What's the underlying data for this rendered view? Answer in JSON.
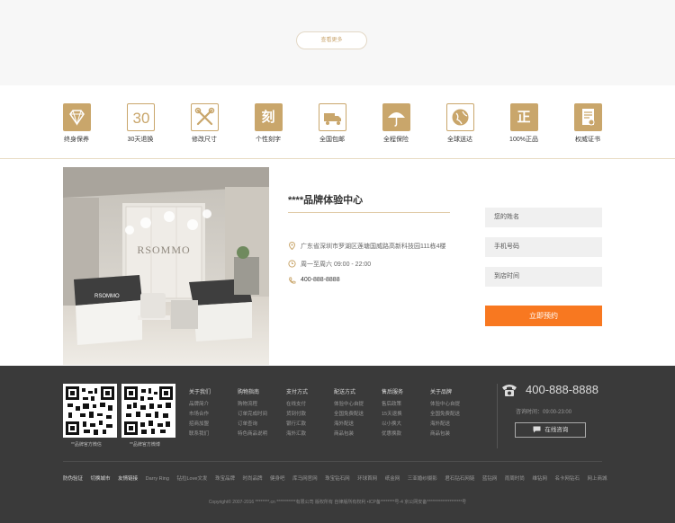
{
  "top": {
    "more_label": "查看更多"
  },
  "services": [
    {
      "label": "终身保养",
      "icon": "diamond-icon"
    },
    {
      "label": "30天退换",
      "icon": "thirty-days-icon",
      "glyph": "30"
    },
    {
      "label": "修改尺寸",
      "icon": "tools-icon"
    },
    {
      "label": "个性刻字",
      "icon": "engrave-icon",
      "glyph": "刻"
    },
    {
      "label": "全国包邮",
      "icon": "truck-icon"
    },
    {
      "label": "全程保险",
      "icon": "umbrella-icon"
    },
    {
      "label": "全球送达",
      "icon": "globe-icon"
    },
    {
      "label": "100%正品",
      "icon": "genuine-icon",
      "glyph": "正"
    },
    {
      "label": "权威证书",
      "icon": "certificate-icon"
    }
  ],
  "store": {
    "title": "****品牌体验中心",
    "address": "广东省深圳市罗湖区莲塘国威路高新科技园111栋4楼",
    "hours": "周一至周六  09:00 - 22:00",
    "phone": "400-888-8888",
    "sign_text": "RSOMMO"
  },
  "booking": {
    "name_placeholder": "您的姓名",
    "phone_placeholder": "手机号码",
    "time_placeholder": "到店时间",
    "submit_label": "立即预约"
  },
  "footer": {
    "qr_captions": [
      "**品牌官方微信",
      "**品牌官方微博"
    ],
    "columns": [
      {
        "title": "关于我们",
        "items": [
          "品牌简介",
          "市场合作",
          "招商加盟",
          "联系我们"
        ]
      },
      {
        "title": "购物指南",
        "items": [
          "购物流程",
          "订单完成时间",
          "订单查询",
          "特色商品说明"
        ]
      },
      {
        "title": "支付方式",
        "items": [
          "在线支付",
          "货到付款",
          "银行汇款",
          "海外汇款"
        ]
      },
      {
        "title": "配送方式",
        "items": [
          "体验中心自提",
          "全国免费配送",
          "海外配送",
          "商品包装"
        ]
      },
      {
        "title": "售后服务",
        "items": [
          "售后政策",
          "15天退换",
          "以小换大",
          "优惠换款"
        ]
      },
      {
        "title": "关于品牌",
        "items": [
          "体验中心自提",
          "全国免费配送",
          "海外配送",
          "商品包装"
        ]
      }
    ],
    "phone": "400-888-8888",
    "hours": "咨询时间：09:00-23:00",
    "consult_label": "在线咨询",
    "links": [
      "防伪验证",
      "切换城市",
      "友情链接",
      "Darry Ring",
      "钻拉Love文发",
      "珠宝品牌",
      "时尚品牌",
      "健身吧",
      "库马网官网",
      "珠宝钻石网",
      "环球首网",
      "纸金网",
      "三亚婚纱摄影",
      "君石钻石网链",
      "蓝钻网",
      "雨周时尚",
      "维钻网",
      "名卡网钻石",
      "网上商城"
    ],
    "copyright": "Copyright© 2007-2016  ********.cn  ***********有限公司  版权所有  自律版所有权利  •ICP备********号-4  京公网安备********************号"
  }
}
